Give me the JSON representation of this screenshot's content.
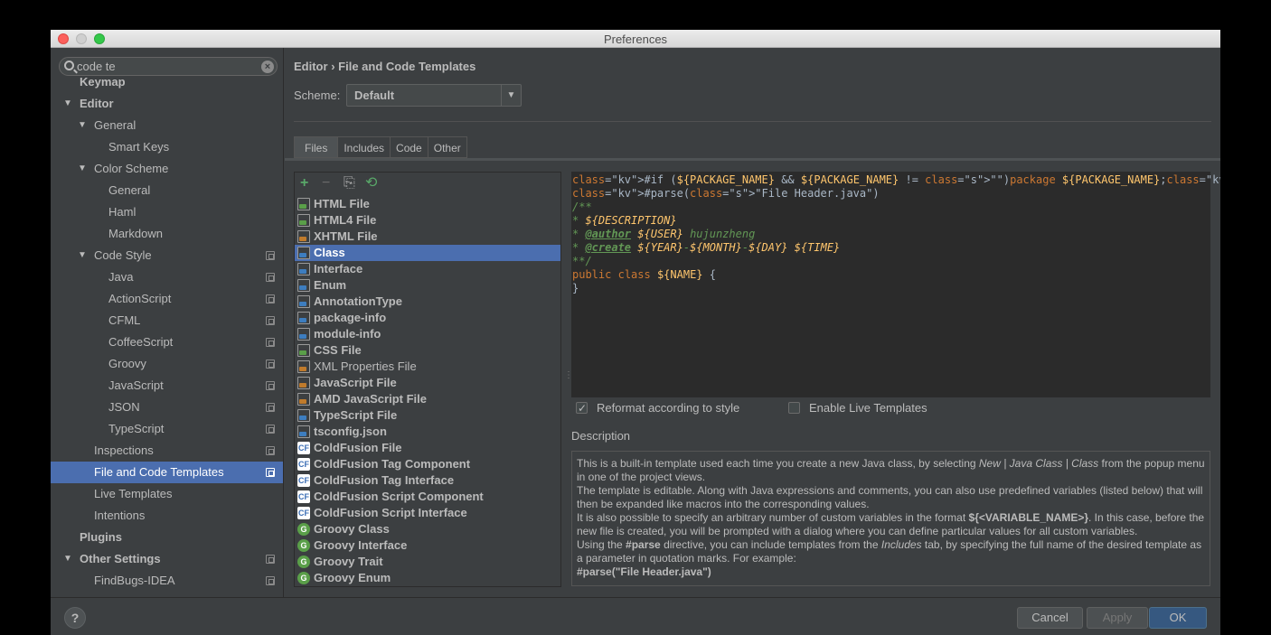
{
  "window": {
    "title": "Preferences"
  },
  "sidebar": {
    "search": {
      "value": "code te"
    },
    "items": [
      {
        "label": "Keymap",
        "level": 0,
        "bold": true
      },
      {
        "label": "Editor",
        "level": 0,
        "bold": true,
        "arrow": "▼"
      },
      {
        "label": "General",
        "level": 1,
        "arrow": "▼"
      },
      {
        "label": "Smart Keys",
        "level": 2
      },
      {
        "label": "Color Scheme",
        "level": 1,
        "arrow": "▼"
      },
      {
        "label": "General",
        "level": 2
      },
      {
        "label": "Haml",
        "level": 2
      },
      {
        "label": "Markdown",
        "level": 2
      },
      {
        "label": "Code Style",
        "level": 1,
        "arrow": "▼",
        "copy": true
      },
      {
        "label": "Java",
        "level": 2,
        "copy": true
      },
      {
        "label": "ActionScript",
        "level": 2,
        "copy": true
      },
      {
        "label": "CFML",
        "level": 2,
        "copy": true
      },
      {
        "label": "CoffeeScript",
        "level": 2,
        "copy": true
      },
      {
        "label": "Groovy",
        "level": 2,
        "copy": true
      },
      {
        "label": "JavaScript",
        "level": 2,
        "copy": true
      },
      {
        "label": "JSON",
        "level": 2,
        "copy": true
      },
      {
        "label": "TypeScript",
        "level": 2,
        "copy": true
      },
      {
        "label": "Inspections",
        "level": 1,
        "copy": true
      },
      {
        "label": "File and Code Templates",
        "level": 1,
        "copy": true,
        "selected": true
      },
      {
        "label": "Live Templates",
        "level": 1
      },
      {
        "label": "Intentions",
        "level": 1
      },
      {
        "label": "Plugins",
        "level": 0,
        "bold": true
      },
      {
        "label": "Other Settings",
        "level": 0,
        "bold": true,
        "arrow": "▼",
        "copy": true
      },
      {
        "label": "FindBugs-IDEA",
        "level": 1,
        "copy": true
      }
    ]
  },
  "breadcrumb": {
    "parent": "Editor",
    "separator": "›",
    "current": "File and Code Templates"
  },
  "scheme": {
    "label": "Scheme:",
    "value": "Default"
  },
  "tabs": [
    "Files",
    "Includes",
    "Code",
    "Other"
  ],
  "toolbar": {
    "add": "+",
    "remove": "−",
    "copy": "⎘",
    "reset": "⟲"
  },
  "templates": [
    {
      "name": "HTML File",
      "icon": "html-file-icon",
      "color": "#5a9f49"
    },
    {
      "name": "HTML4 File",
      "icon": "html-file-icon",
      "color": "#5a9f49"
    },
    {
      "name": "XHTML File",
      "icon": "html-file-icon",
      "color": "#c07b2c"
    },
    {
      "name": "Class",
      "icon": "java-file-icon",
      "color": "#3d7dbf",
      "selected": true
    },
    {
      "name": "Interface",
      "icon": "java-file-icon",
      "color": "#3d7dbf"
    },
    {
      "name": "Enum",
      "icon": "java-file-icon",
      "color": "#3d7dbf"
    },
    {
      "name": "AnnotationType",
      "icon": "java-file-icon",
      "color": "#3d7dbf"
    },
    {
      "name": "package-info",
      "icon": "java-file-icon",
      "color": "#3d7dbf"
    },
    {
      "name": "module-info",
      "icon": "java-file-icon",
      "color": "#3d7dbf"
    },
    {
      "name": "CSS File",
      "icon": "css-file-icon",
      "color": "#5a9f49"
    },
    {
      "name": "XML Properties File",
      "icon": "xml-file-icon",
      "color": "#c07b2c",
      "normal": true
    },
    {
      "name": "JavaScript File",
      "icon": "js-file-icon",
      "color": "#c07b2c"
    },
    {
      "name": "AMD JavaScript File",
      "icon": "js-file-icon",
      "color": "#c07b2c"
    },
    {
      "name": "TypeScript File",
      "icon": "ts-file-icon",
      "color": "#3d7dbf"
    },
    {
      "name": "tsconfig.json",
      "icon": "json-file-icon",
      "color": "#3d7dbf"
    },
    {
      "name": "ColdFusion File",
      "icon": "coldfusion-icon",
      "kind": "cf"
    },
    {
      "name": "ColdFusion Tag Component",
      "icon": "coldfusion-icon",
      "kind": "cf"
    },
    {
      "name": "ColdFusion Tag Interface",
      "icon": "coldfusion-icon",
      "kind": "cf"
    },
    {
      "name": "ColdFusion Script Component",
      "icon": "coldfusion-icon",
      "kind": "cf"
    },
    {
      "name": "ColdFusion Script Interface",
      "icon": "coldfusion-icon",
      "kind": "cf"
    },
    {
      "name": "Groovy Class",
      "icon": "groovy-icon",
      "kind": "gr"
    },
    {
      "name": "Groovy Interface",
      "icon": "groovy-icon",
      "kind": "gr"
    },
    {
      "name": "Groovy Trait",
      "icon": "groovy-icon",
      "kind": "gr"
    },
    {
      "name": "Groovy Enum",
      "icon": "groovy-icon",
      "kind": "gr"
    }
  ],
  "editor": {
    "lines": [
      "#if (${PACKAGE_NAME} && ${PACKAGE_NAME} != \"\")package ${PACKAGE_NAME};#end",
      "#parse(\"File Header.java\")",
      "/**",
      "* ${DESCRIPTION}",
      "* @author ${USER} hujunzheng",
      "* @create ${YEAR}-${MONTH}-${DAY} ${TIME}",
      "**/",
      "public class ${NAME} {",
      "}"
    ]
  },
  "options": {
    "reformat": {
      "label": "Reformat according to style",
      "checked": true
    },
    "live_templates": {
      "label": "Enable Live Templates",
      "checked": false
    }
  },
  "description": {
    "label": "Description",
    "p1a": "This is a built-in template used each time you create a new Java class, by selecting ",
    "p1b": "New | Java Class | Class",
    "p1c": " from the popup menu in one of the project views.",
    "p2": "The template is editable. Along with Java expressions and comments, you can also use predefined variables (listed below) that will then be expanded like macros into the corresponding values.",
    "p3a": "It is also possible to specify an arbitrary number of custom variables in the format ",
    "p3b": "${<VARIABLE_NAME>}",
    "p3c": ". In this case, before the new file is created, you will be prompted with a dialog where you can define particular values for all custom variables.",
    "p4a": "Using the ",
    "p4b": "#parse",
    "p4c": " directive, you can include templates from the ",
    "p4d": "Includes",
    "p4e": " tab, by specifying the full name of the desired template as a parameter in quotation marks. For example:",
    "p5": "#parse(\"File Header.java\")"
  },
  "buttons": {
    "help": "?",
    "cancel": "Cancel",
    "apply": "Apply",
    "ok": "OK"
  }
}
